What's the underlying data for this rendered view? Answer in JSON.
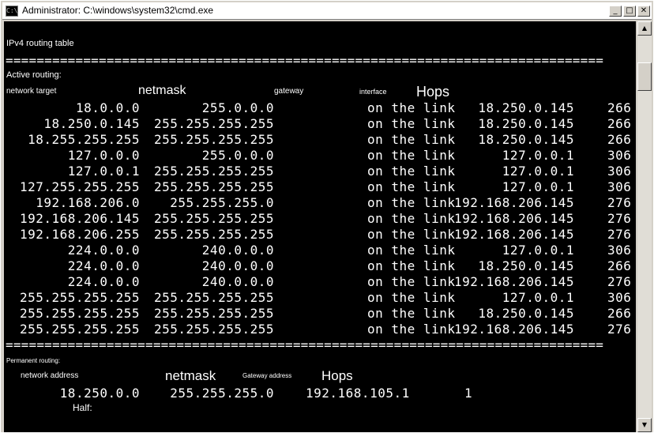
{
  "window": {
    "title": "Administrator: C:\\windows\\system32\\cmd.exe",
    "icon_label": "C:\\",
    "controls": {
      "minimize": "_",
      "maximize": "□",
      "close": "✕"
    }
  },
  "scrollbar": {
    "up": "▲",
    "down": "▼"
  },
  "console": {
    "table_title": "IPv4 routing table",
    "separator": "=============================================================================",
    "active_label": "Active routing:",
    "headers": {
      "network_target": "network target",
      "netmask": "netmask",
      "gateway": "gateway",
      "interface": "interface",
      "hops": "Hops"
    },
    "routes": [
      {
        "target": "18.0.0.0",
        "netmask": "255.0.0.0",
        "gateway": "on the link",
        "interface": "18.250.0.145",
        "hops": "266"
      },
      {
        "target": "18.250.0.145",
        "netmask": "255.255.255.255",
        "gateway": "on the link",
        "interface": "18.250.0.145",
        "hops": "266"
      },
      {
        "target": "18.255.255.255",
        "netmask": "255.255.255.255",
        "gateway": "on the link",
        "interface": "18.250.0.145",
        "hops": "266"
      },
      {
        "target": "127.0.0.0",
        "netmask": "255.0.0.0",
        "gateway": "on the link",
        "interface": "127.0.0.1",
        "hops": "306"
      },
      {
        "target": "127.0.0.1",
        "netmask": "255.255.255.255",
        "gateway": "on the link",
        "interface": "127.0.0.1",
        "hops": "306"
      },
      {
        "target": "127.255.255.255",
        "netmask": "255.255.255.255",
        "gateway": "on the link",
        "interface": "127.0.0.1",
        "hops": "306"
      },
      {
        "target": "192.168.206.0",
        "netmask": "255.255.255.0",
        "gateway": "on the link",
        "interface": "192.168.206.145",
        "hops": "276"
      },
      {
        "target": "192.168.206.145",
        "netmask": "255.255.255.255",
        "gateway": "on the link",
        "interface": "192.168.206.145",
        "hops": "276"
      },
      {
        "target": "192.168.206.255",
        "netmask": "255.255.255.255",
        "gateway": "on the link",
        "interface": "192.168.206.145",
        "hops": "276"
      },
      {
        "target": "224.0.0.0",
        "netmask": "240.0.0.0",
        "gateway": "on the link",
        "interface": "127.0.0.1",
        "hops": "306"
      },
      {
        "target": "224.0.0.0",
        "netmask": "240.0.0.0",
        "gateway": "on the link",
        "interface": "18.250.0.145",
        "hops": "266"
      },
      {
        "target": "224.0.0.0",
        "netmask": "240.0.0.0",
        "gateway": "on the link",
        "interface": "192.168.206.145",
        "hops": "276"
      },
      {
        "target": "255.255.255.255",
        "netmask": "255.255.255.255",
        "gateway": "on the link",
        "interface": "127.0.0.1",
        "hops": "306"
      },
      {
        "target": "255.255.255.255",
        "netmask": "255.255.255.255",
        "gateway": "on the link",
        "interface": "18.250.0.145",
        "hops": "266"
      },
      {
        "target": "255.255.255.255",
        "netmask": "255.255.255.255",
        "gateway": "on the link",
        "interface": "192.168.206.145",
        "hops": "276"
      }
    ],
    "permanent_label": "Permanent routing:",
    "permanent_headers": {
      "network_address": "network address",
      "netmask": "netmask",
      "gateway_address": "Gateway address",
      "hops": "Hops"
    },
    "permanent_routes": [
      {
        "address": "18.250.0.0",
        "netmask": "255.255.255.0",
        "gateway": "192.168.105.1",
        "hops": "1"
      }
    ],
    "half_label": "Half:"
  },
  "colors": {
    "console_bg": "#000000",
    "console_fg": "#ffffff",
    "chrome": "#d4d0c8"
  }
}
